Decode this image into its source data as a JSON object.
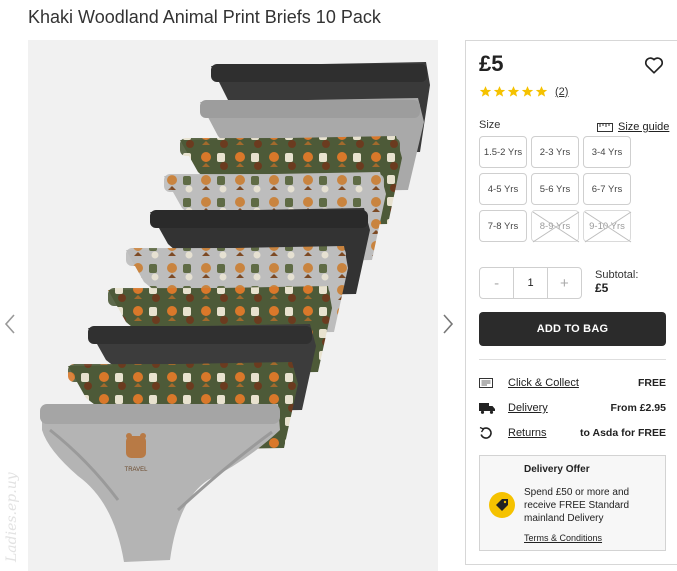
{
  "product": {
    "title": "Khaki Woodland Animal Print Briefs 10 Pack",
    "price": "£5",
    "rating": 5,
    "review_count": "(2)"
  },
  "icons": {
    "favourite": "heart-outline-icon",
    "star": "star-icon",
    "size_guide": "ruler-icon",
    "click_collect": "store-card-icon",
    "delivery": "truck-icon",
    "returns": "return-arrow-icon",
    "offer": "price-tag-icon",
    "prev": "chevron-left-icon",
    "next": "chevron-right-icon"
  },
  "colors": {
    "star": "#f5c200",
    "button": "#2b2b2b",
    "offer_badge": "#f5c200"
  },
  "size_selector": {
    "label": "Size",
    "guide_label": "Size guide",
    "options": [
      {
        "label": "1.5-2 Yrs",
        "available": true
      },
      {
        "label": "2-3 Yrs",
        "available": true
      },
      {
        "label": "3-4 Yrs",
        "available": true
      },
      {
        "label": "4-5 Yrs",
        "available": true
      },
      {
        "label": "5-6 Yrs",
        "available": true
      },
      {
        "label": "6-7 Yrs",
        "available": true
      },
      {
        "label": "7-8 Yrs",
        "available": true
      },
      {
        "label": "8-9 Yrs",
        "available": false
      },
      {
        "label": "9-10 Yrs",
        "available": false
      }
    ]
  },
  "quantity": {
    "minus": "-",
    "value": "1",
    "plus": "+"
  },
  "subtotal": {
    "label": "Subtotal:",
    "amount": "£5"
  },
  "add_to_bag": "ADD TO BAG",
  "delivery_options": [
    {
      "label": "Click & Collect",
      "value": "FREE"
    },
    {
      "label": "Delivery",
      "value": "From £2.95"
    },
    {
      "label": "Returns",
      "value": "to Asda for FREE"
    }
  ],
  "offer": {
    "title": "Delivery Offer",
    "text": "Spend £50 or more and receive FREE Standard mainland Delivery",
    "link": "Terms & Conditions"
  },
  "gallery": {
    "watermark": "Ladies.ep.uy",
    "print_tag": "TRAVEL"
  }
}
